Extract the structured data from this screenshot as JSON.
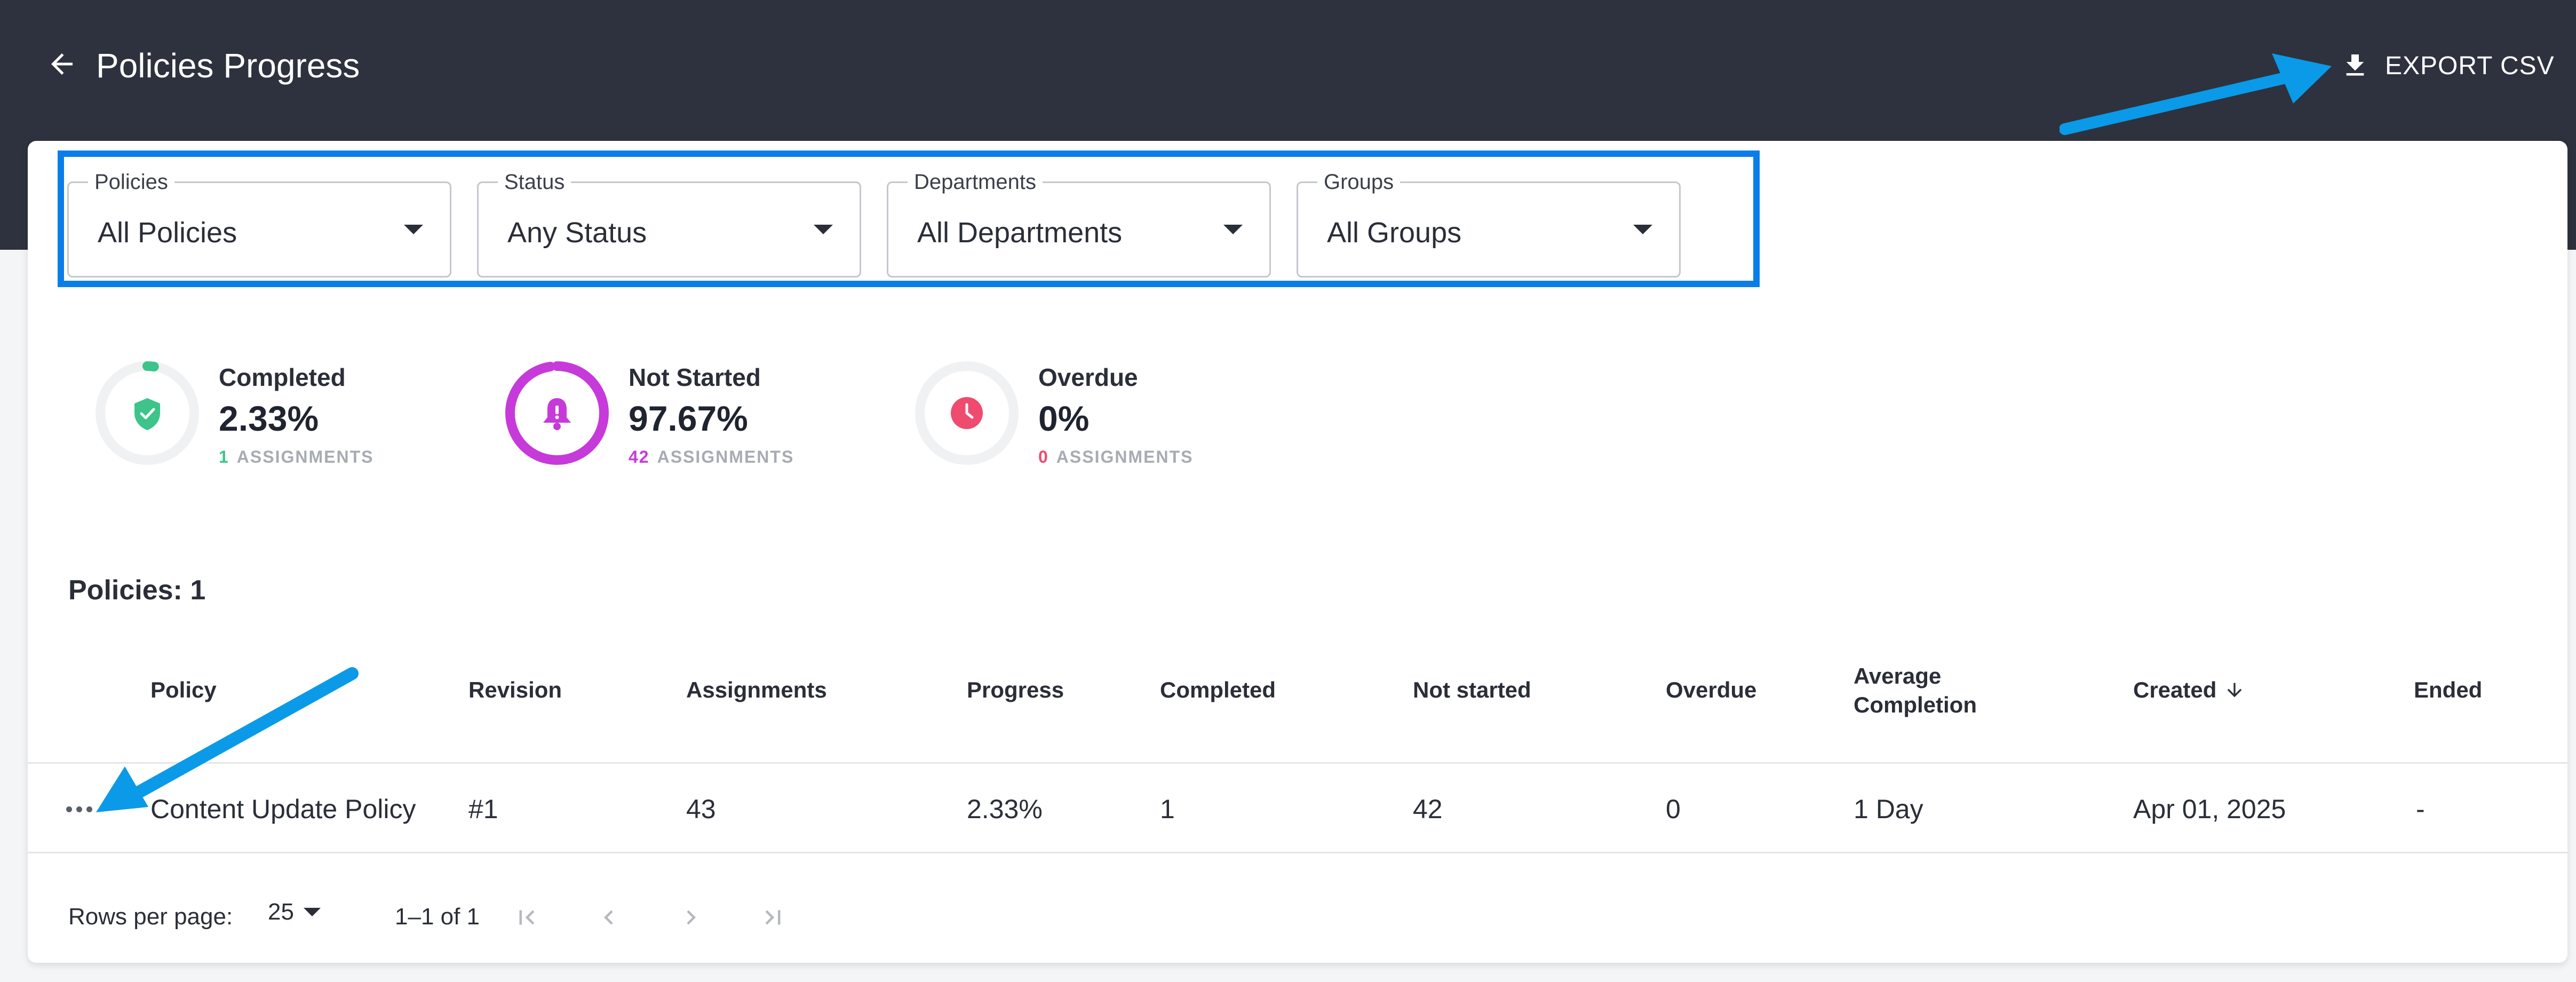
{
  "header": {
    "title": "Policies Progress",
    "export_label": "EXPORT CSV"
  },
  "filters": [
    {
      "legend": "Policies",
      "value": "All Policies"
    },
    {
      "legend": "Status",
      "value": "Any Status"
    },
    {
      "legend": "Departments",
      "value": "All Departments"
    },
    {
      "legend": "Groups",
      "value": "All Groups"
    }
  ],
  "stats": [
    {
      "label": "Completed",
      "percent": "2.33%",
      "count": "1",
      "unit": "ASSIGNMENTS",
      "color": "#3cc48a",
      "fraction": 0.0233,
      "icon": "shield-check-icon"
    },
    {
      "label": "Not Started",
      "percent": "97.67%",
      "count": "42",
      "unit": "ASSIGNMENTS",
      "color": "#c63ad9",
      "fraction": 0.9767,
      "icon": "bell-icon"
    },
    {
      "label": "Overdue",
      "percent": "0%",
      "count": "0",
      "unit": "ASSIGNMENTS",
      "color": "#ef4b6e",
      "fraction": 0,
      "icon": "clock-icon"
    }
  ],
  "policies_count": "Policies: 1",
  "table": {
    "columns": {
      "policy": "Policy",
      "revision": "Revision",
      "assignments": "Assignments",
      "progress": "Progress",
      "completed": "Completed",
      "not_started": "Not started",
      "overdue": "Overdue",
      "avg_completion_1": "Average",
      "avg_completion_2": "Completion",
      "created": "Created",
      "ended": "Ended"
    },
    "rows": [
      {
        "policy": "Content Update Policy",
        "revision": "#1",
        "assignments": "43",
        "progress": "2.33%",
        "completed": "1",
        "not_started": "42",
        "overdue": "0",
        "avg_completion": "1 Day",
        "created": "Apr 01, 2025",
        "ended": "-"
      }
    ]
  },
  "pagination": {
    "rows_per_page_label": "Rows per page:",
    "rows_per_page_value": "25",
    "range": "1–1 of 1"
  },
  "colors": {
    "topbar": "#2e323e",
    "highlight_box": "#0a7ee8",
    "annotation_arrow": "#0a9ae8"
  }
}
